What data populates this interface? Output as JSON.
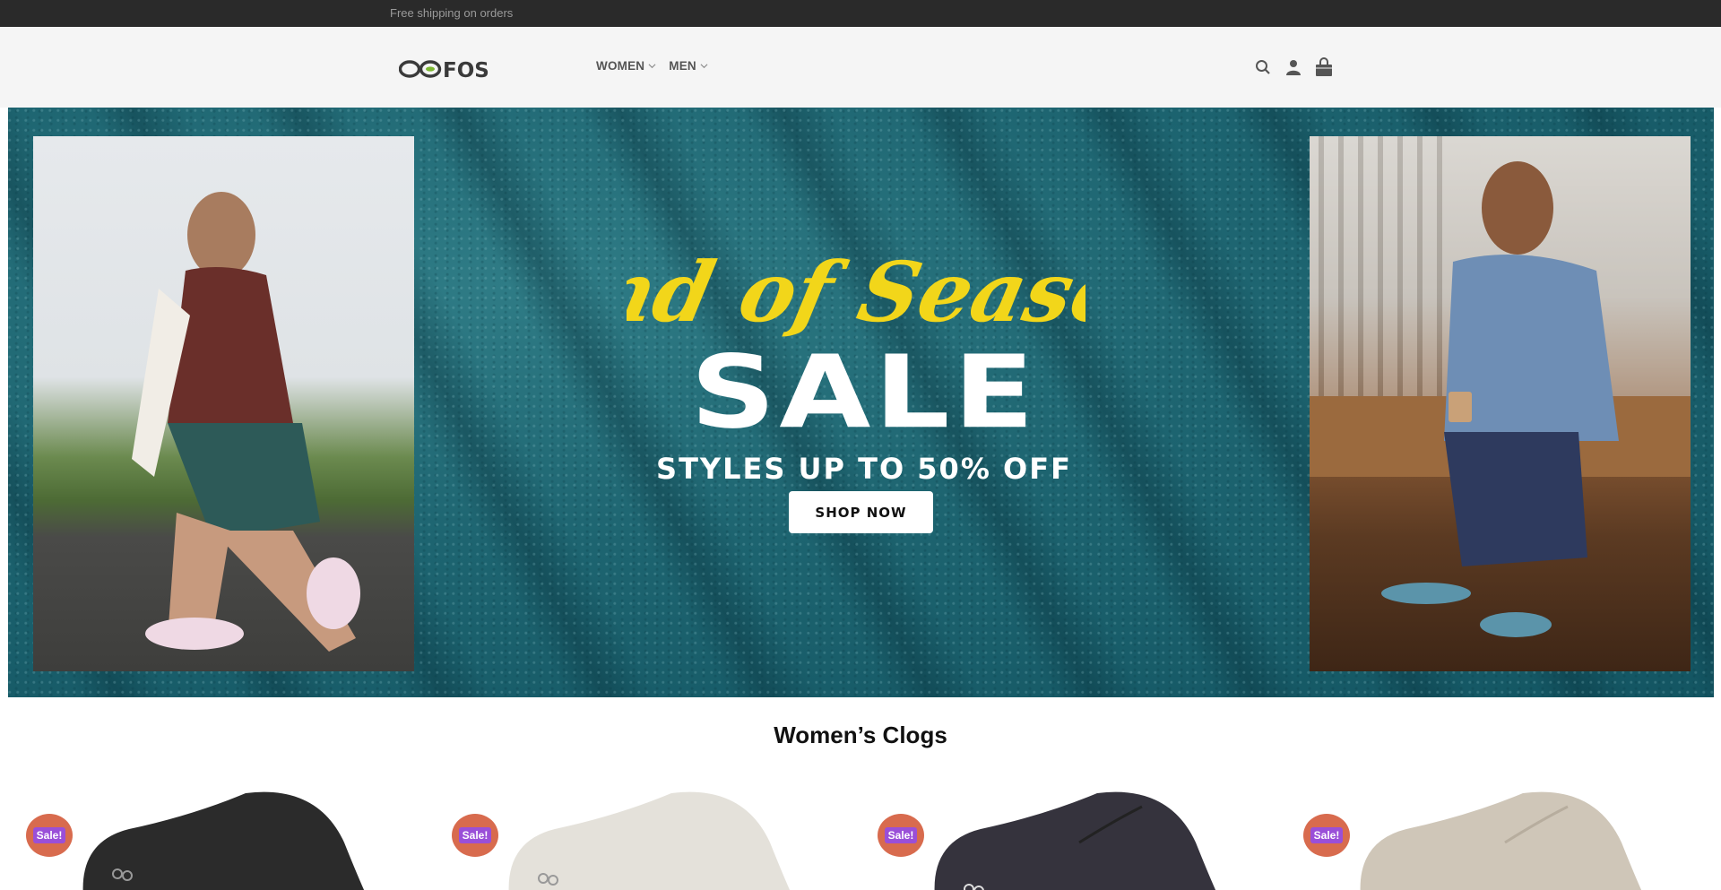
{
  "topbar": {
    "text": "Free shipping on orders"
  },
  "header": {
    "logo_text": "OOFOS",
    "nav": [
      {
        "label": "WOMEN"
      },
      {
        "label": "MEN"
      }
    ],
    "icons": [
      "search-icon",
      "account-icon",
      "cart-icon"
    ]
  },
  "hero": {
    "script_text": "End of Season",
    "headline": "SALE",
    "subheadline": "STYLES UP TO 50% OFF",
    "cta": "SHOP NOW",
    "colors": {
      "background": "#1d6470",
      "script": "#f2d61a"
    }
  },
  "section": {
    "title": "Women’s Clogs"
  },
  "products": [
    {
      "badge": "Sale!",
      "color": "#2b2b2b"
    },
    {
      "badge": "Sale!",
      "color": "#e4e1da"
    },
    {
      "badge": "Sale!",
      "color": "#35333d"
    },
    {
      "badge": "Sale!",
      "color": "#cfc6b8"
    }
  ]
}
